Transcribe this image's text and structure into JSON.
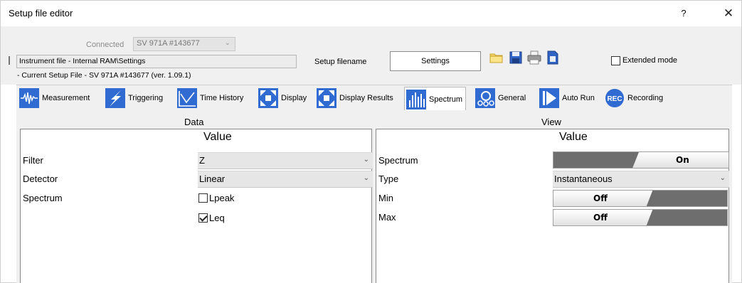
{
  "window": {
    "title": "Setup file editor",
    "help_label": "?",
    "close_label": "✕"
  },
  "header": {
    "connected_label": "Connected",
    "connected_value": "SV 971A #143677",
    "instrument_file": "Instrument file - Internal RAM\\Settings",
    "current_setup_file": "- Current Setup File  - SV 971A #143677 (ver. 1.09.1)",
    "setup_filename_label": "Setup filename",
    "setup_filename_value": "Settings",
    "extended_mode_label": "Extended mode",
    "icons": [
      "folder-icon",
      "save-icon",
      "print-icon",
      "export-icon"
    ]
  },
  "tabs": [
    {
      "label": "Measurement",
      "icon": "measurement-icon"
    },
    {
      "label": "Triggering",
      "icon": "triggering-icon"
    },
    {
      "label": "Time History",
      "icon": "time-history-icon"
    },
    {
      "label": "Display",
      "icon": "display-icon"
    },
    {
      "label": "Display Results",
      "icon": "display-results-icon"
    },
    {
      "label": "Spectrum",
      "icon": "spectrum-icon",
      "active": true
    },
    {
      "label": "General",
      "icon": "general-icon"
    },
    {
      "label": "Auto Run",
      "icon": "auto-run-icon"
    },
    {
      "label": "Recording",
      "icon": "recording-icon"
    }
  ],
  "data": {
    "title": "Data",
    "value_header": "Value",
    "filter_label": "Filter",
    "filter_value": "Z",
    "detector_label": "Detector",
    "detector_value": "Linear",
    "spectrum_label": "Spectrum",
    "lpeak_label": "Lpeak",
    "lpeak_checked": false,
    "leq_label": "Leq",
    "leq_checked": true
  },
  "view": {
    "title": "View",
    "value_header": "Value",
    "spectrum_label": "Spectrum",
    "spectrum_toggle": "On",
    "type_label": "Type",
    "type_value": "Instantaneous",
    "min_label": "Min",
    "min_toggle": "Off",
    "max_label": "Max",
    "max_toggle": "Off"
  },
  "colors": {
    "accent_blue": "#1f5fbf",
    "window_bg": "#f0f0f0",
    "toggle_dark": "#6e6e6e"
  }
}
